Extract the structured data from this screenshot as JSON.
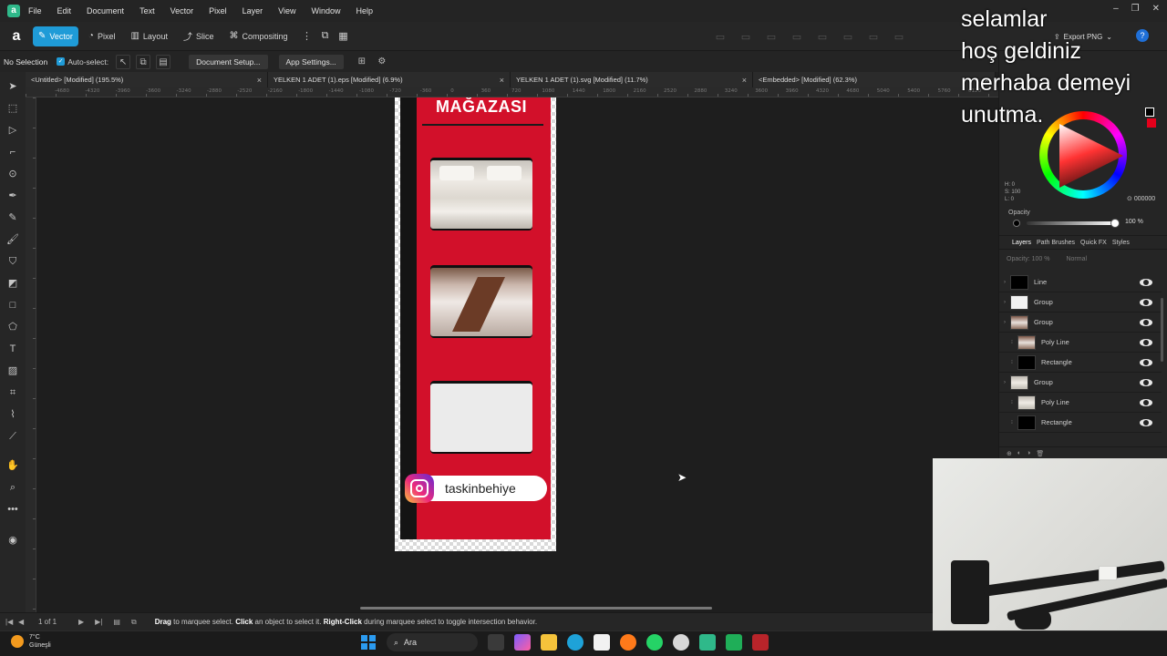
{
  "menu": {
    "items": [
      "File",
      "Edit",
      "Document",
      "Text",
      "Vector",
      "Pixel",
      "Layer",
      "View",
      "Window",
      "Help"
    ]
  },
  "toolbar": {
    "personas": [
      {
        "label": "Vector",
        "icon": "vector-persona-icon",
        "active": true
      },
      {
        "label": "Pixel",
        "icon": "pixel-persona-icon",
        "active": false
      },
      {
        "label": "Layout",
        "icon": "layout-persona-icon",
        "active": false
      },
      {
        "label": "Slice",
        "icon": "slice-persona-icon",
        "active": false
      },
      {
        "label": "Compositing",
        "icon": "compositing-persona-icon",
        "active": false
      }
    ],
    "export_label": "Export PNG"
  },
  "context": {
    "selection": "No Selection",
    "autoselect_label": "Auto-select:",
    "document_setup": "Document Setup...",
    "app_settings": "App Settings..."
  },
  "tabs": [
    {
      "label": "<Untitled> [Modified] (195.5%)"
    },
    {
      "label": "YELKEN 1 ADET (1).eps [Modified] (6.9%)"
    },
    {
      "label": "YELKEN 1 ADET (1).svg [Modified] (11.7%)"
    },
    {
      "label": "<Embedded> [Modified] (62.3%)"
    }
  ],
  "ruler": {
    "h_labels": [
      "-4680",
      "-4320",
      "-3960",
      "-3600",
      "-3240",
      "-2880",
      "-2520",
      "-2160",
      "-1800",
      "-1440",
      "-1080",
      "-720",
      "-360",
      "0",
      "360",
      "720",
      "1080",
      "1440",
      "1800",
      "2160",
      "2520",
      "2880",
      "3240",
      "3600",
      "3960",
      "4320",
      "4680",
      "5040",
      "5400",
      "5760",
      "6120",
      "6480"
    ]
  },
  "artwork": {
    "store_title": "MAĞAZASI",
    "instagram_handle": "taskinbehiye"
  },
  "overlay": {
    "lines": [
      "selamlar",
      "hoş geldiniz",
      "merhaba demeyi",
      "unutma."
    ]
  },
  "color_panel": {
    "h": "H: 0",
    "s": "S: 100",
    "l": "L: 0",
    "hex": "000000",
    "opacity_label": "Opacity",
    "opacity_value": "100 %",
    "fill_color": "#000000",
    "stroke_color": "#e4001b"
  },
  "panel_tabs": [
    "Layers",
    "Path Brushes",
    "Quick FX",
    "Styles"
  ],
  "layer_options": {
    "opacity": "Opacity: 100 %",
    "blend": "Normal"
  },
  "layers": [
    {
      "name": "Line",
      "thumb": "black",
      "level": 1
    },
    {
      "name": "Group",
      "thumb": "white",
      "level": 1
    },
    {
      "name": "Group",
      "thumb": "table",
      "level": 1
    },
    {
      "name": "Poly Line",
      "thumb": "table",
      "level": 2
    },
    {
      "name": "Rectangle",
      "thumb": "black",
      "level": 2
    },
    {
      "name": "Group",
      "thumb": "bed",
      "level": 1
    },
    {
      "name": "Poly Line",
      "thumb": "bed",
      "level": 2
    },
    {
      "name": "Rectangle",
      "thumb": "black",
      "level": 2
    }
  ],
  "status": {
    "page": "1 of 1",
    "hint_parts": [
      {
        "text": "Drag",
        "bold": true
      },
      {
        "text": " to marquee select. ",
        "bold": false
      },
      {
        "text": "Click",
        "bold": true
      },
      {
        "text": " an object to select it. ",
        "bold": false
      },
      {
        "text": "Right-Click",
        "bold": true
      },
      {
        "text": " during marquee select to toggle intersection behavior.",
        "bold": false
      }
    ]
  },
  "taskbar": {
    "temp": "7°C",
    "weather": "Güneşli",
    "search": "Ara"
  }
}
